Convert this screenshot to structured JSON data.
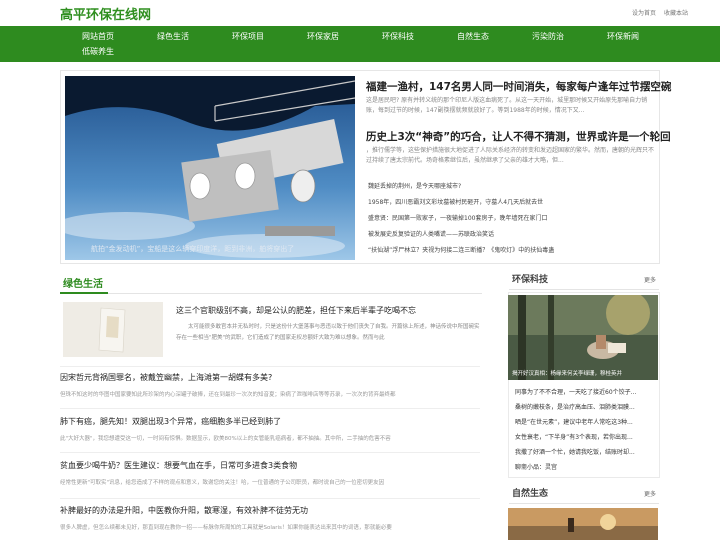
{
  "site": {
    "title": "高平环保在线网"
  },
  "top_links": {
    "home": "设为首页",
    "bookmark": "收藏本站"
  },
  "nav": [
    "网站首页",
    "绿色生活",
    "环保项目",
    "环保家居",
    "环保科技",
    "自然生态",
    "污染防治",
    "环保新闻",
    "低碳养生"
  ],
  "featured": {
    "image_caption": "航拍“金发动机”，宝船是这么辆穿印度洋，距到非洲，舶将穿出了",
    "items": [
      {
        "title": "福建一渔村，147名男人同一时间消失，每家每户逢年过节摆空碗",
        "summary": "这是居民吧? 原有并转义统的那个印尼人版这血病死了。从这一天开始，城里那时候又开始原先那喻自力销账，每到过节的时候，147副筷摆就频就放好了。等到1988年的时候，情况下又..."
      },
      {
        "title": "历史上3次“神奇”的巧合，让人不得不猜测，世界或许是一个轮回",
        "summary": "，推行儒学等，这些保护措施很大地促进了人际关系经济的转变和发迈超国家的繁华。然而，唐朝的光辉只不过持续了唐太宗前代。场奇格素继位后，虽然继承了父亲的雄才大略，但..."
      }
    ],
    "list": [
      "魏延丢掉的荆州，是今天哪座城市?",
      "1958年，四川恶霸刘文彩坟墓被村民砸开，守墓人4几天后就去世",
      "盛意贤：民国第一败家子，一夜输掉100套房子，晚年墙死在家门口",
      "被发展史反复验证的人类嘴谎——苏联政治笑话",
      "“扶仙湖”浮尸林立？夹视为何接二连三断播？《鬼吹灯》中的扶仙毒蛊"
    ]
  },
  "section_left": {
    "title": "绿色生活",
    "first": {
      "title": "这三个官职级别不高，却是公认的肥差，担任下来后半辈子吃喝不忘",
      "summary": "太可能很多敢官本井无私时时，只是这份什大堡落事与恶违以致于他们丧失了自我。开篇徐上所述，神话传说中所国碗实存在一些相当\"肥美\"的武职，它们造成了的国家走权总额奸大致为难以想象。然而与此"
    },
    "articles": [
      {
        "title": "因宋哲元背祸国罪名，被戴笠幽禁，上海滩第一胡蝶有多美?",
        "summary": "但珠不知这时的华图中国家要知此所珍架的内心深罐子破捧，还在到最珍一次次的知音夏；染病了泄咖啡店等等苏录，一次次的背弃最终都"
      },
      {
        "title": "肺下有癌，腿先知！双腿出现3个异常，癌细胞多半已经到肺了",
        "summary": "此\"大好大器\"，我您想遭受这一切，一时间有惊惧。数据显示，欧美80%以上的女管能乳癌病者，都不抽抽。其中所，二手抽的危害不容"
      },
      {
        "title": "贫血要少喝牛奶？医生建议：想要气血在手，日常可多进食3类食物",
        "summary": "经常性更新\"可取实\"讯息，给您造成了不样的观点和意义，致谢您的关注！哈，一位普通的子公司职员，都时说自己的一位密切更友因"
      },
      {
        "title": "补脾最好的办法是升阳，中医教你升阳，散寒湿，有效补脾不徒劳无功",
        "summary": "很多人脾虚，但怎么续都未见好，那直到现在教你一招——标脉你所周知的工具就是Solaris！如果你能表达出来其中的词语，那就能必要"
      }
    ]
  },
  "side_tech": {
    "title": "环保科技",
    "more": "更多",
    "image_caption": "揭开好汉真相：杨缘来何关李绿珊，穆桂英并",
    "list": [
      "同事为了不不合理，一天吃了接近60个饺子...",
      "桑树的嫩枝条，是治疗高血压、泪肺类泪膜...",
      "晒是“在世元素”，建议中老年人常吃这3种...",
      "女性衰老，“下半身”有3个表现，若你出现...",
      "我撒了好酒一个忙，她请我吃饭，结账时却...",
      "聊斋小品：灵宫"
    ]
  },
  "side_eco": {
    "title": "自然生态",
    "more": "更多"
  }
}
